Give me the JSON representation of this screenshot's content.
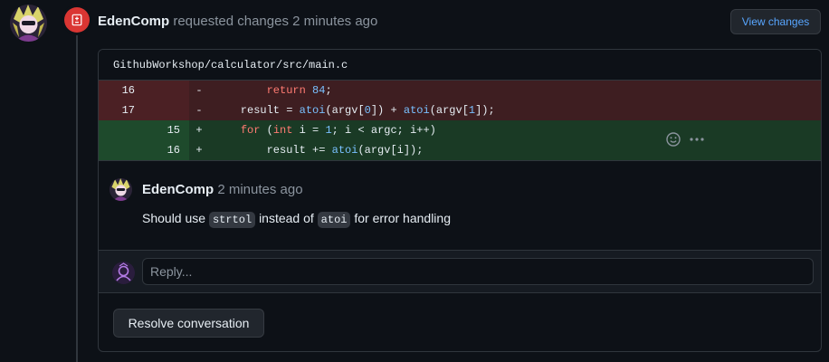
{
  "review": {
    "user": "EdenComp",
    "action": "requested changes",
    "time": "2 minutes ago",
    "view_changes_label": "View changes",
    "badge_icon": "file-diff-icon",
    "badge_color": "#da3633"
  },
  "file": {
    "path": "GithubWorkshop/calculator/src/main.c",
    "lines": [
      {
        "type": "del",
        "old": "16",
        "new": "",
        "sign": "-"
      },
      {
        "type": "del",
        "old": "17",
        "new": "",
        "sign": "-"
      },
      {
        "type": "add",
        "old": "",
        "new": "15",
        "sign": "+"
      },
      {
        "type": "add",
        "old": "",
        "new": "16",
        "sign": "+"
      }
    ]
  },
  "comment": {
    "user": "EdenComp",
    "time": "2 minutes ago",
    "text_before": "Should use",
    "code1": "strtol",
    "text_middle": "instead of",
    "code2": "atoi",
    "text_after": "for error handling"
  },
  "reply": {
    "placeholder": "Reply..."
  },
  "resolve_label": "Resolve conversation"
}
